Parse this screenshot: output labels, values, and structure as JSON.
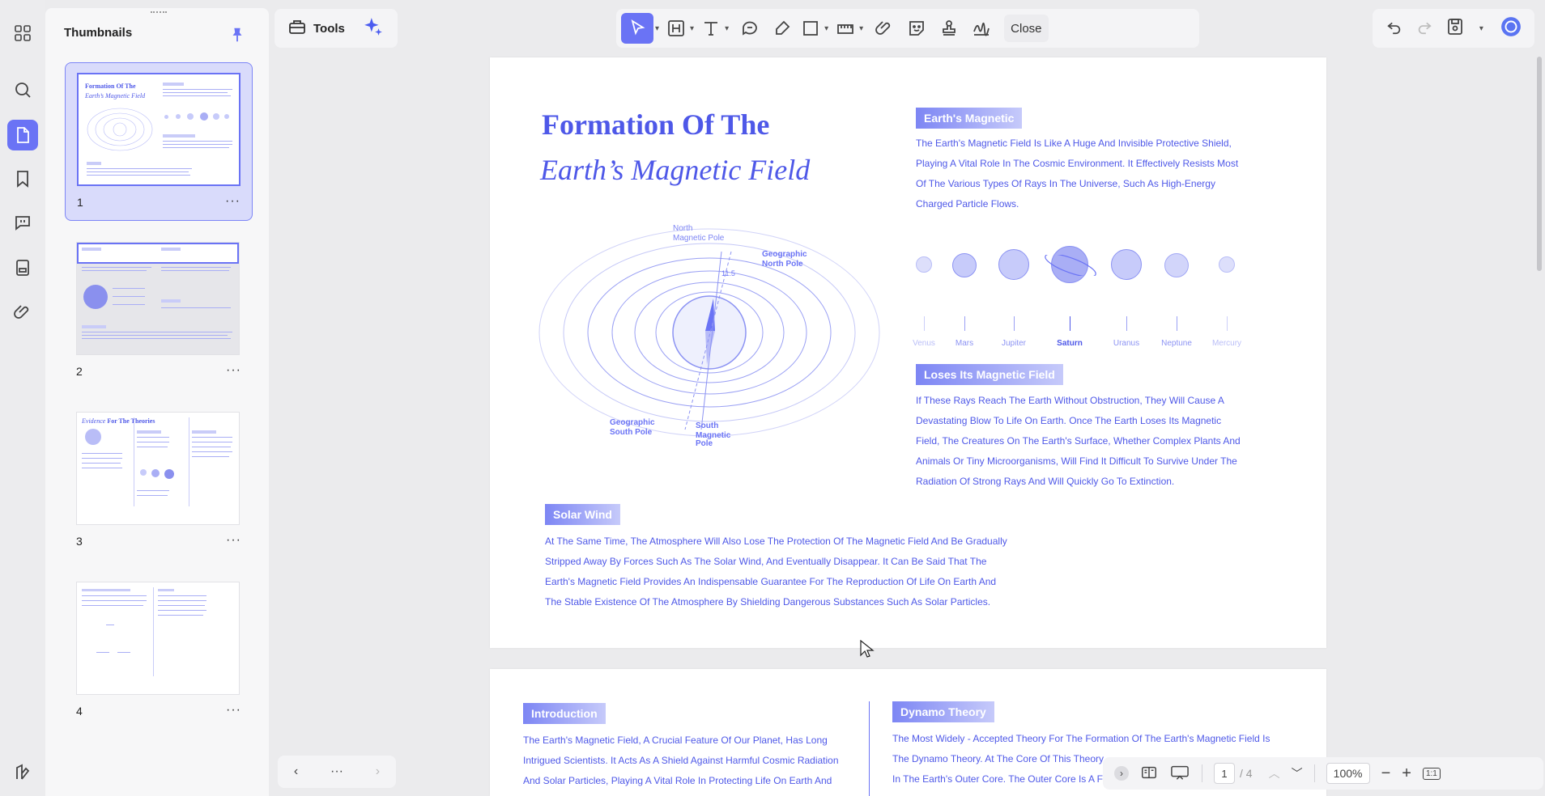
{
  "sidebar": {
    "panel_title": "Thumbnails",
    "pages": [
      {
        "number": "1",
        "selected": true
      },
      {
        "number": "2",
        "selected": false
      },
      {
        "number": "3",
        "selected": false
      },
      {
        "number": "4",
        "selected": false
      }
    ],
    "thumb3_title_italic": "Evidence",
    "thumb3_title_rest": " For The Theories"
  },
  "toolbar": {
    "tools_label": "Tools",
    "close_label": "Close"
  },
  "document": {
    "title_line1": "Formation Of The",
    "title_line2": "Earth’s Magnetic Field",
    "tag_earths_magnetic": "Earth's Magnetic",
    "earths_magnetic_lines": [
      "The Earth's Magnetic Field Is Like A Huge And Invisible Protective Shield,",
      "Playing A Vital Role In The Cosmic Environment. It Effectively Resists Most",
      "Of The Various Types Of Rays In The Universe, Such As High-Energy",
      "Charged Particle Flows."
    ],
    "planets": [
      "Venus",
      "Mars",
      "Jupiter",
      "Saturn",
      "Uranus",
      "Neptune",
      "Mercury"
    ],
    "diagram_labels": {
      "north_magnetic_1": "North",
      "north_magnetic_2": "Magnetic Pole",
      "geo_north_1": "Geographic",
      "geo_north_2": "North Pole",
      "angle": "11.5",
      "geo_south_1": "Geographic",
      "geo_south_2": "South Pole",
      "south_magnetic_1": "South",
      "south_magnetic_2": "Magnetic",
      "south_magnetic_3": "Pole"
    },
    "tag_loses": "Loses Its Magnetic Field",
    "loses_lines": [
      "If These Rays Reach The Earth Without Obstruction, They Will Cause A",
      "Devastating Blow To Life On Earth. Once The Earth Loses Its Magnetic",
      "Field, The Creatures On The Earth's Surface, Whether Complex Plants And",
      "Animals Or Tiny Microorganisms, Will Find It Difficult To Survive Under The",
      "Radiation Of Strong Rays And Will Quickly Go To Extinction."
    ],
    "tag_solar": "Solar Wind",
    "solar_lines": [
      "At The Same Time, The Atmosphere Will Also Lose The Protection Of The Magnetic Field And Be Gradually",
      "Stripped Away By Forces Such As The Solar Wind, And Eventually Disappear. It Can Be Said That The",
      "Earth's Magnetic Field Provides An Indispensable Guarantee For The Reproduction Of Life On Earth And",
      "The Stable Existence Of The Atmosphere By Shielding Dangerous Substances Such As Solar Particles."
    ],
    "page2": {
      "tag_intro": "Introduction",
      "intro_lines": [
        "The Earth's Magnetic Field, A Crucial Feature Of Our Planet, Has Long",
        "Intrigued Scientists. It Acts As A Shield Against Harmful Cosmic Radiation",
        "And Solar Particles, Playing A Vital Role In Protecting Life On Earth And"
      ],
      "tag_dynamo": "Dynamo Theory",
      "dynamo_lines": [
        "The Most Widely - Accepted Theory For The Formation Of The Earth's Magnetic Field Is",
        "The Dynamo Theory. At The Core Of This Theory",
        "In The Earth's Outer Core. The Outer Core Is A Fl"
      ]
    }
  },
  "status": {
    "current_page": "1",
    "total_pages": "/ 4",
    "zoom": "100%",
    "fit_label": "1:1",
    "nav_more": "···"
  },
  "colors": {
    "accent": "#6a73f5",
    "doc_text": "#4e58e8",
    "selected_thumb_bg": "#d9dbfb"
  }
}
